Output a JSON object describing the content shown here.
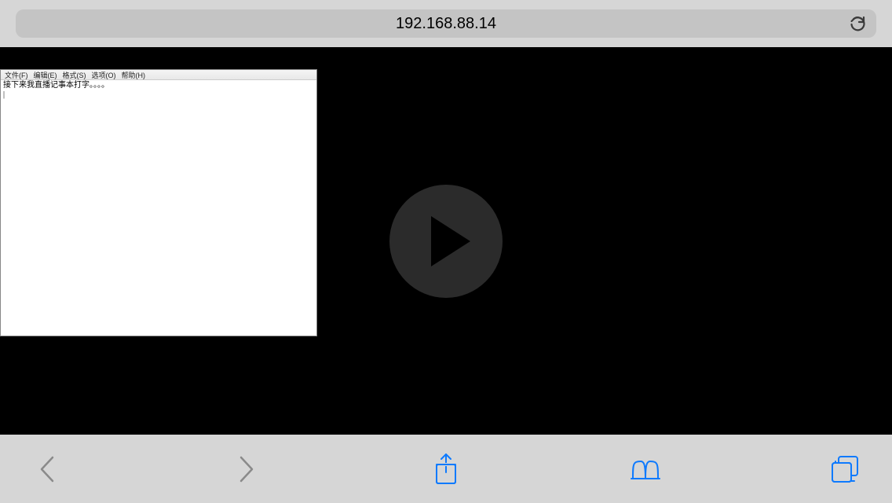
{
  "address_bar": {
    "url": "192.168.88.14"
  },
  "notepad": {
    "menu": {
      "file": "文件(F)",
      "edit": "编辑(E)",
      "format": "格式(S)",
      "view": "选项(O)",
      "help": "帮助(H)"
    },
    "content": "接下来我直播记事本打字。。。。\n|"
  },
  "icons": {
    "reload": "reload-icon",
    "back": "back-icon",
    "forward": "forward-icon",
    "share": "share-icon",
    "bookmarks": "bookmarks-icon",
    "tabs": "tabs-icon",
    "play": "play-icon"
  },
  "colors": {
    "toolbar_bg": "#d6d6d6",
    "accent_blue": "#0e7afe",
    "nav_gray": "#888888"
  }
}
